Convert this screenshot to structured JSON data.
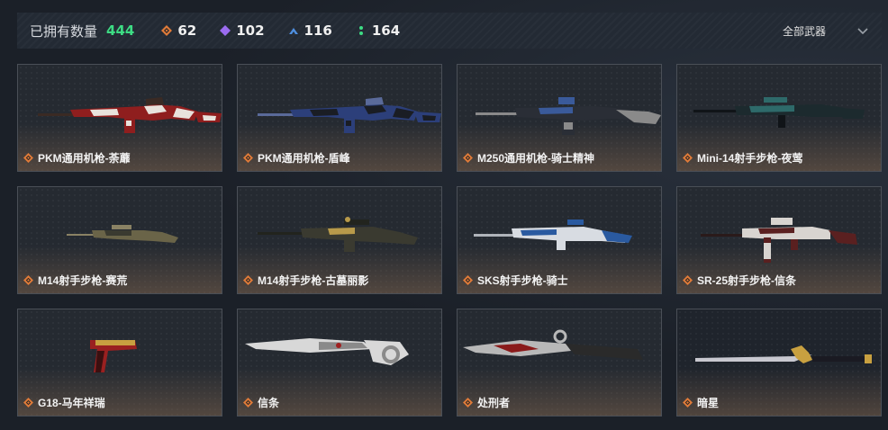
{
  "header": {
    "owned_label": "已拥有数量",
    "owned_count": "444",
    "stats": [
      {
        "icon": "orange-diamond-icon",
        "value": "62",
        "color": "#e07b39"
      },
      {
        "icon": "purple-diamond-icon",
        "value": "102",
        "color": "#9b6cf0"
      },
      {
        "icon": "blue-chevron-icon",
        "value": "116",
        "color": "#4e8fe0"
      },
      {
        "icon": "green-dots-icon",
        "value": "164",
        "color": "#3ddc84"
      }
    ],
    "filter_label": "全部武器"
  },
  "items": [
    {
      "name": "PKM通用机枪-荼蘼",
      "type": "lmg",
      "palette": [
        "#8f1e1e",
        "#e8e2dc",
        "#3a2a24"
      ]
    },
    {
      "name": "PKM通用机枪-盾峰",
      "type": "lmg",
      "palette": [
        "#2c3f7a",
        "#1a1d24",
        "#5a6a9a"
      ]
    },
    {
      "name": "M250通用机枪-骑士精神",
      "type": "lmg2",
      "palette": [
        "#2a2e36",
        "#3a5a9a",
        "#8a8a8a"
      ]
    },
    {
      "name": "Mini-14射手步枪-夜莺",
      "type": "rifle",
      "palette": [
        "#1c2a2e",
        "#2e6a6a",
        "#101418"
      ]
    },
    {
      "name": "M14射手步枪-赛荒",
      "type": "dmr",
      "palette": [
        "#6a6448",
        "#3a3a30",
        "#8a8264"
      ]
    },
    {
      "name": "M14射手步枪-古墓丽影",
      "type": "dmr2",
      "palette": [
        "#3a3a30",
        "#b89a4a",
        "#22241e"
      ]
    },
    {
      "name": "SKS射手步枪-骑士",
      "type": "sks",
      "palette": [
        "#d8dce2",
        "#2a5aa0",
        "#b0b4ba"
      ]
    },
    {
      "name": "SR-25射手步枪-信条",
      "type": "rifle2",
      "palette": [
        "#5a2020",
        "#d8d4d0",
        "#2a1a1a"
      ]
    },
    {
      "name": "G18-马年祥瑞",
      "type": "pistol",
      "palette": [
        "#9a2020",
        "#c8a040",
        "#3a1010"
      ]
    },
    {
      "name": "信条",
      "type": "knife",
      "palette": [
        "#d8d8d8",
        "#8a8a8a",
        "#a02020"
      ]
    },
    {
      "name": "处刑者",
      "type": "knife2",
      "palette": [
        "#b8b8b8",
        "#8a1a1a",
        "#2a2a2a"
      ]
    },
    {
      "name": "暗星",
      "type": "knife3",
      "palette": [
        "#c8c8d0",
        "#c8a040",
        "#1a1a22"
      ]
    }
  ],
  "rarity_color": "#e07b39"
}
